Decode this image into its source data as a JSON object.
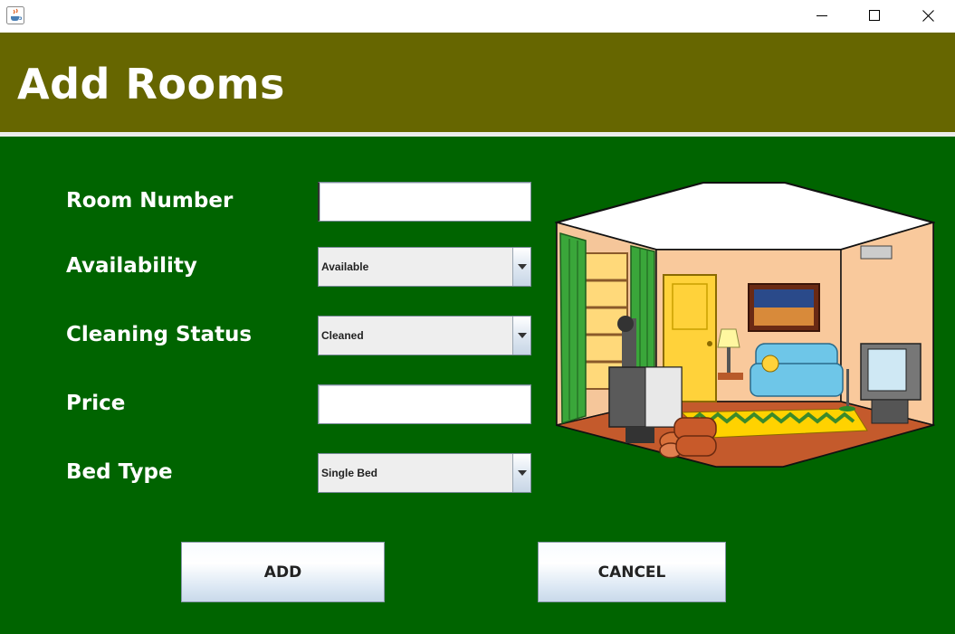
{
  "window": {
    "title": "",
    "controls": {
      "minimize": "minimize",
      "maximize": "maximize",
      "close": "close"
    }
  },
  "header": {
    "title": "Add Rooms",
    "background_color": "#666600"
  },
  "form": {
    "background_color": "#006400",
    "fields": [
      {
        "label": "Room Number",
        "type": "text",
        "value": ""
      },
      {
        "label": "Availability",
        "type": "select",
        "value": "Available"
      },
      {
        "label": "Cleaning Status",
        "type": "select",
        "value": "Cleaned"
      },
      {
        "label": "Price",
        "type": "text",
        "value": ""
      },
      {
        "label": "Bed Type",
        "type": "select",
        "value": "Single Bed"
      }
    ]
  },
  "buttons": {
    "add": "ADD",
    "cancel": "CANCEL"
  },
  "icons": {
    "app": "java-cup-icon",
    "minimize": "minimize-icon",
    "maximize": "maximize-icon",
    "close": "close-icon",
    "dropdown": "chevron-down-icon"
  }
}
